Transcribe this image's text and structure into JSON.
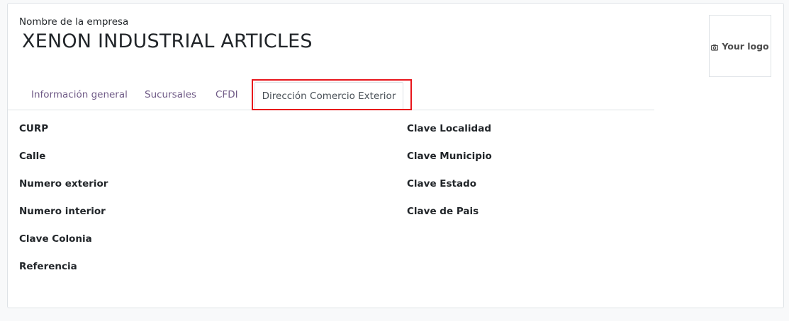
{
  "header": {
    "company_caption": "Nombre de la empresa",
    "company_name": "XENON INDUSTRIAL ARTICLES",
    "logo_label": "Your logo",
    "logo_icon": "camera-icon"
  },
  "tabs": [
    {
      "label": "Información general",
      "active": false
    },
    {
      "label": "Sucursales",
      "active": false
    },
    {
      "label": "CFDI",
      "active": false
    },
    {
      "label": "Dirección Comercio Exterior",
      "active": true
    }
  ],
  "fields_left": [
    {
      "label": "CURP"
    },
    {
      "label": "Calle"
    },
    {
      "label": "Numero exterior"
    },
    {
      "label": "Numero interior"
    },
    {
      "label": "Clave Colonia"
    },
    {
      "label": "Referencia"
    }
  ],
  "fields_right": [
    {
      "label": "Clave Localidad"
    },
    {
      "label": "Clave Municipio"
    },
    {
      "label": "Clave Estado"
    },
    {
      "label": "Clave de Pais"
    }
  ],
  "colors": {
    "tab_text": "#6f5a86",
    "highlight_border": "#e8151b",
    "sheet_bg": "#ffffff",
    "page_bg": "#f8f9fa"
  }
}
